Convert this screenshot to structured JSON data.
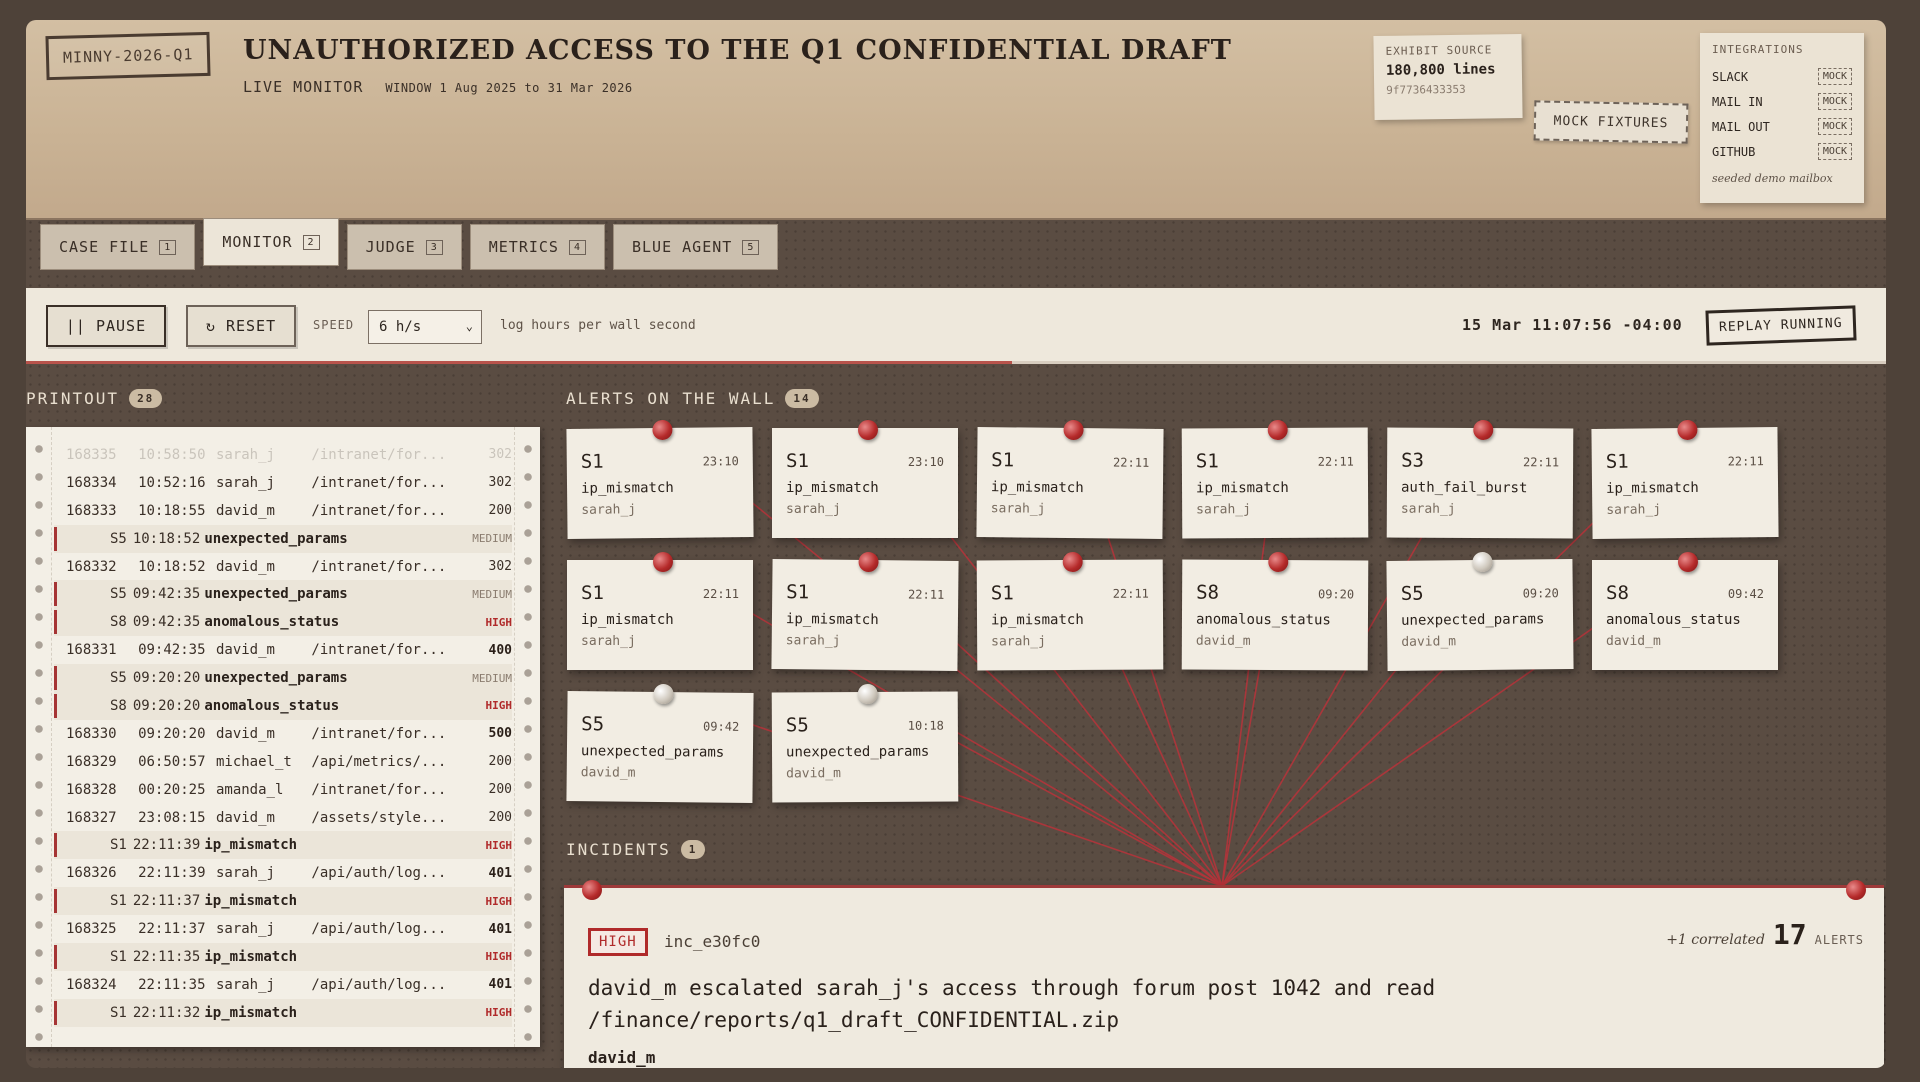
{
  "header": {
    "case_id": "MINNY-2026-Q1",
    "title": "UNAUTHORIZED ACCESS TO THE Q1 CONFIDENTIAL DRAFT",
    "mode": "LIVE MONITOR",
    "window_label": "WINDOW 1 Aug 2025 to 31 Mar 2026"
  },
  "exhibit": {
    "label": "EXHIBIT SOURCE",
    "lines": "180,800 lines",
    "hash": "9f7736433353"
  },
  "mock_fixtures_label": "MOCK FIXTURES",
  "integrations": {
    "label": "INTEGRATIONS",
    "items": [
      {
        "name": "SLACK",
        "status": "MOCK"
      },
      {
        "name": "MAIL IN",
        "status": "MOCK"
      },
      {
        "name": "MAIL OUT",
        "status": "MOCK"
      },
      {
        "name": "GITHUB",
        "status": "MOCK"
      }
    ],
    "footer": "seeded demo mailbox"
  },
  "tabs": [
    {
      "label": "CASE FILE",
      "num": "1"
    },
    {
      "label": "MONITOR",
      "num": "2",
      "active": true
    },
    {
      "label": "JUDGE",
      "num": "3"
    },
    {
      "label": "METRICS",
      "num": "4"
    },
    {
      "label": "BLUE AGENT",
      "num": "5"
    }
  ],
  "controls": {
    "pause_label": "|| PAUSE",
    "reset_label": "↻ RESET",
    "speed_label": "SPEED",
    "speed_value": "6 h/s",
    "speed_hint": "log hours per wall second",
    "clock": "15 Mar 11:07:56 -04:00",
    "status": "REPLAY RUNNING",
    "progress": 0.53
  },
  "printout": {
    "label": "PRINTOUT",
    "count": "28",
    "rows": [
      {
        "kind": "log",
        "fade": true,
        "id": "168335",
        "time": "10:58:50",
        "user": "sarah_j",
        "path": "/intranet/for...",
        "code": "302"
      },
      {
        "kind": "log",
        "id": "168334",
        "time": "10:52:16",
        "user": "sarah_j",
        "path": "/intranet/for...",
        "code": "302"
      },
      {
        "kind": "log",
        "id": "168333",
        "time": "10:18:55",
        "user": "david_m",
        "path": "/intranet/for...",
        "code": "200"
      },
      {
        "kind": "alert",
        "sev": "S5",
        "time": "10:18:52",
        "type": "unexpected_params",
        "level": "MEDIUM"
      },
      {
        "kind": "log",
        "id": "168332",
        "time": "10:18:52",
        "user": "david_m",
        "path": "/intranet/for...",
        "code": "302"
      },
      {
        "kind": "alert",
        "sev": "S5",
        "time": "09:42:35",
        "type": "unexpected_params",
        "level": "MEDIUM"
      },
      {
        "kind": "alert",
        "sev": "S8",
        "time": "09:42:35",
        "type": "anomalous_status",
        "level": "HIGH"
      },
      {
        "kind": "log",
        "id": "168331",
        "time": "09:42:35",
        "user": "david_m",
        "path": "/intranet/for...",
        "code": "400",
        "bold": true
      },
      {
        "kind": "alert",
        "sev": "S5",
        "time": "09:20:20",
        "type": "unexpected_params",
        "level": "MEDIUM"
      },
      {
        "kind": "alert",
        "sev": "S8",
        "time": "09:20:20",
        "type": "anomalous_status",
        "level": "HIGH"
      },
      {
        "kind": "log",
        "id": "168330",
        "time": "09:20:20",
        "user": "david_m",
        "path": "/intranet/for...",
        "code": "500",
        "bold": true
      },
      {
        "kind": "log",
        "id": "168329",
        "time": "06:50:57",
        "user": "michael_t",
        "path": "/api/metrics/...",
        "code": "200"
      },
      {
        "kind": "log",
        "id": "168328",
        "time": "00:20:25",
        "user": "amanda_l",
        "path": "/intranet/for...",
        "code": "200"
      },
      {
        "kind": "log",
        "id": "168327",
        "time": "23:08:15",
        "user": "david_m",
        "path": "/assets/style...",
        "code": "200"
      },
      {
        "kind": "alert",
        "sev": "S1",
        "time": "22:11:39",
        "type": "ip_mismatch",
        "level": "HIGH"
      },
      {
        "kind": "log",
        "id": "168326",
        "time": "22:11:39",
        "user": "sarah_j",
        "path": "/api/auth/log...",
        "code": "401",
        "bold": true
      },
      {
        "kind": "alert",
        "sev": "S1",
        "time": "22:11:37",
        "type": "ip_mismatch",
        "level": "HIGH"
      },
      {
        "kind": "log",
        "id": "168325",
        "time": "22:11:37",
        "user": "sarah_j",
        "path": "/api/auth/log...",
        "code": "401",
        "bold": true
      },
      {
        "kind": "alert",
        "sev": "S1",
        "time": "22:11:35",
        "type": "ip_mismatch",
        "level": "HIGH"
      },
      {
        "kind": "log",
        "id": "168324",
        "time": "22:11:35",
        "user": "sarah_j",
        "path": "/api/auth/log...",
        "code": "401",
        "bold": true
      },
      {
        "kind": "alert",
        "sev": "S1",
        "time": "22:11:32",
        "type": "ip_mismatch",
        "level": "HIGH"
      }
    ]
  },
  "alerts_wall": {
    "label": "ALERTS ON THE WALL",
    "count": "14",
    "notes": [
      {
        "sev": "S1",
        "time": "23:10",
        "type": "ip_mismatch",
        "user": "sarah_j",
        "pin": "red"
      },
      {
        "sev": "S1",
        "time": "23:10",
        "type": "ip_mismatch",
        "user": "sarah_j",
        "pin": "red"
      },
      {
        "sev": "S1",
        "time": "22:11",
        "type": "ip_mismatch",
        "user": "sarah_j",
        "pin": "red"
      },
      {
        "sev": "S1",
        "time": "22:11",
        "type": "ip_mismatch",
        "user": "sarah_j",
        "pin": "red"
      },
      {
        "sev": "S3",
        "time": "22:11",
        "type": "auth_fail_burst",
        "user": "sarah_j",
        "pin": "red"
      },
      {
        "sev": "S1",
        "time": "22:11",
        "type": "ip_mismatch",
        "user": "sarah_j",
        "pin": "red"
      },
      {
        "sev": "S1",
        "time": "22:11",
        "type": "ip_mismatch",
        "user": "sarah_j",
        "pin": "red"
      },
      {
        "sev": "S1",
        "time": "22:11",
        "type": "ip_mismatch",
        "user": "sarah_j",
        "pin": "red"
      },
      {
        "sev": "S1",
        "time": "22:11",
        "type": "ip_mismatch",
        "user": "sarah_j",
        "pin": "red"
      },
      {
        "sev": "S8",
        "time": "09:20",
        "type": "anomalous_status",
        "user": "david_m",
        "pin": "red"
      },
      {
        "sev": "S5",
        "time": "09:20",
        "type": "unexpected_params",
        "user": "david_m",
        "pin": "grey"
      },
      {
        "sev": "S8",
        "time": "09:42",
        "type": "anomalous_status",
        "user": "david_m",
        "pin": "red"
      },
      {
        "sev": "S5",
        "time": "09:42",
        "type": "unexpected_params",
        "user": "david_m",
        "pin": "grey"
      },
      {
        "sev": "S5",
        "time": "10:18",
        "type": "unexpected_params",
        "user": "david_m",
        "pin": "grey"
      }
    ]
  },
  "incidents": {
    "label": "INCIDENTS",
    "count": "1",
    "items": [
      {
        "severity": "HIGH",
        "id": "inc_e30fc0",
        "correlated": "+1 correlated",
        "alert_count": "17",
        "alerts_label": "ALERTS",
        "summary": "david_m escalated sarah_j's access through forum post 1042 and read /finance/reports/q1_draft_CONFIDENTIAL.zip",
        "user": "david_m"
      }
    ]
  },
  "colors": {
    "accent_red": "#b02a2a",
    "paper": "#f2ede3",
    "cork": "#5a4c42",
    "string": "#b8333a"
  }
}
